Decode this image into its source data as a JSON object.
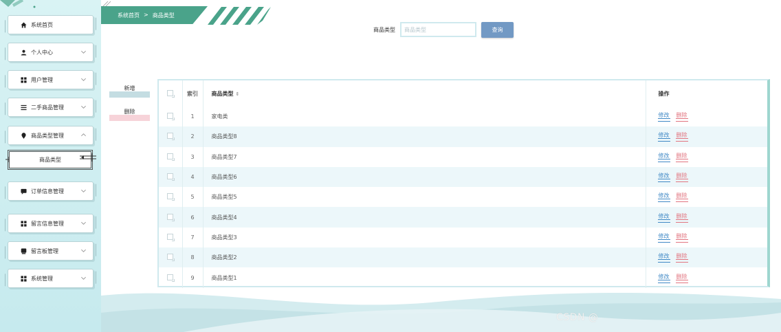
{
  "breadcrumb": {
    "home": "系统首页",
    "separator": ">",
    "current": "商品类型"
  },
  "sidebar": {
    "items": [
      {
        "label": "系统首页",
        "icon": "home-icon",
        "has_chevron": false
      },
      {
        "label": "个人中心",
        "icon": "user-icon",
        "has_chevron": true
      },
      {
        "label": "用户管理",
        "icon": "grid-icon",
        "has_chevron": true
      },
      {
        "label": "二手商品管理",
        "icon": "list-icon",
        "has_chevron": true
      },
      {
        "label": "商品类型管理",
        "icon": "location-icon",
        "has_chevron": true,
        "expanded": true
      },
      {
        "label": "订单信息管理",
        "icon": "chat-icon",
        "has_chevron": true
      },
      {
        "label": "留言信息管理",
        "icon": "grid-icon",
        "has_chevron": true
      },
      {
        "label": "留言板管理",
        "icon": "message-icon",
        "has_chevron": true
      },
      {
        "label": "系统管理",
        "icon": "grid-icon",
        "has_chevron": true
      }
    ],
    "submenu": {
      "label": "商品类型"
    },
    "colors": {
      "bg": "#d9f3f4",
      "item_bg": "#ffffff"
    }
  },
  "search": {
    "label": "商品类型",
    "placeholder": "商品类型",
    "value": "",
    "button_label": "查询"
  },
  "actions": {
    "add_label": "新增",
    "delete_label": "删除"
  },
  "table": {
    "headers": {
      "check": "",
      "index": "索引",
      "type": "商品类型",
      "operations": "操作"
    },
    "rows": [
      {
        "index": "1",
        "type": "家电类"
      },
      {
        "index": "2",
        "type": "商品类型8"
      },
      {
        "index": "3",
        "type": "商品类型7"
      },
      {
        "index": "4",
        "type": "商品类型6"
      },
      {
        "index": "5",
        "type": "商品类型5"
      },
      {
        "index": "6",
        "type": "商品类型4"
      },
      {
        "index": "7",
        "type": "商品类型3"
      },
      {
        "index": "8",
        "type": "商品类型2"
      },
      {
        "index": "9",
        "type": "商品类型1"
      }
    ],
    "edit_label": "修改",
    "delete_label": "删除"
  },
  "watermark": "CSDN @",
  "colors": {
    "accent": "#4aa38a",
    "search_button": "#7299c4",
    "edit_link": "#3f88c5",
    "delete_link": "#e2747f",
    "stripe_row": "#ecf7fa"
  }
}
